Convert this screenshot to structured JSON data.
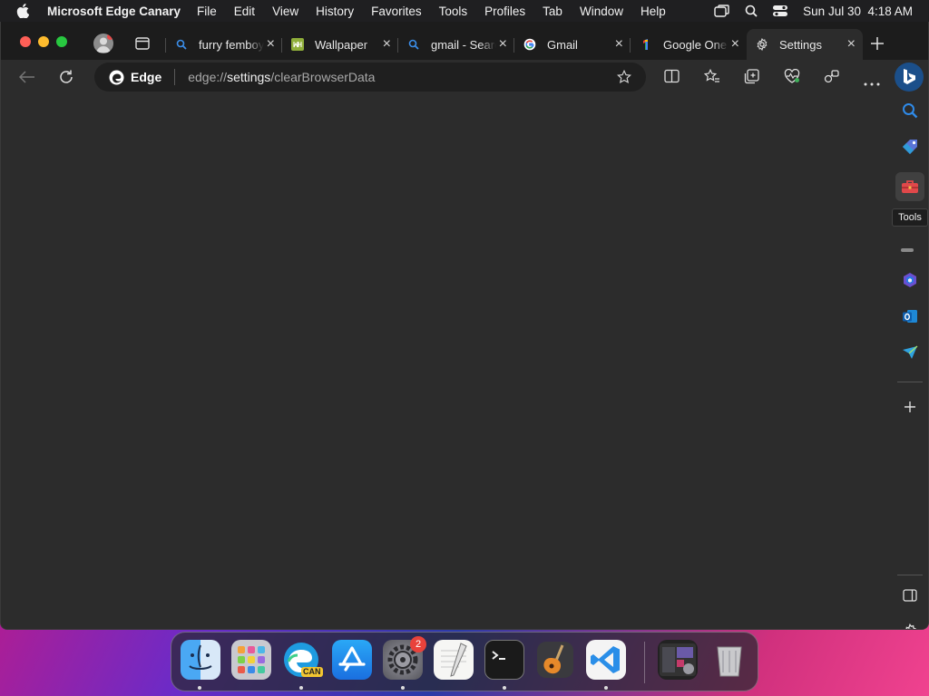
{
  "menubar": {
    "app_name": "Microsoft Edge Canary",
    "items": [
      "File",
      "Edit",
      "View",
      "History",
      "Favorites",
      "Tools",
      "Profiles",
      "Tab",
      "Window",
      "Help"
    ],
    "clock": "Sun Jul 30  4:18 AM"
  },
  "tabs": [
    {
      "label": "furry femboy",
      "icon": "bing-search-icon"
    },
    {
      "label": "Wallpaper",
      "icon": "wallpaper-site-icon"
    },
    {
      "label": "gmail - Search",
      "icon": "bing-search-icon"
    },
    {
      "label": "Gmail",
      "icon": "google-icon"
    },
    {
      "label": "Google One",
      "icon": "google-one-icon"
    },
    {
      "label": "Settings",
      "icon": "gear-icon",
      "active": true
    }
  ],
  "address_bar": {
    "site_label": "Edge",
    "url_prefix": "edge://",
    "url_host": "settings",
    "url_path": "/clearBrowserData"
  },
  "sidebar": {
    "tooltip": "Tools"
  },
  "dock": {
    "badge_count": "2",
    "edge_label": "CAN"
  },
  "colors": {
    "window_bg": "#2c2c2c",
    "tabstrip_bg": "#1c1c1c",
    "accent_blue": "#3b8eea"
  }
}
